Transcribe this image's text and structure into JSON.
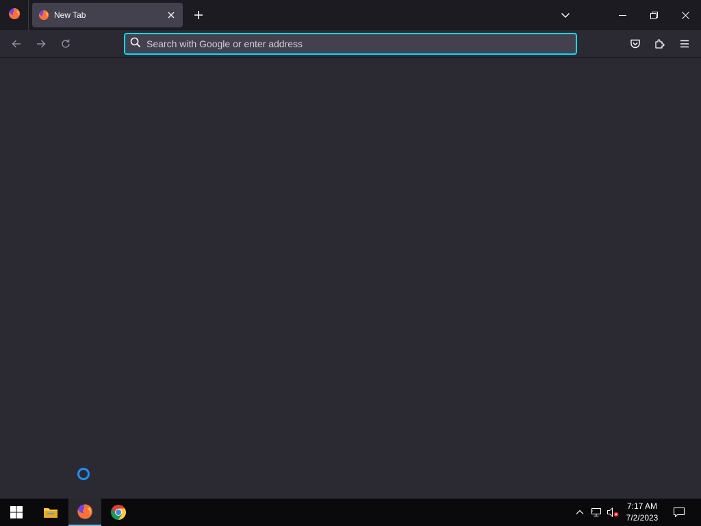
{
  "browser": {
    "tab": {
      "title": "New Tab"
    },
    "urlbar": {
      "placeholder": "Search with Google or enter address",
      "value": ""
    },
    "accent_color": "#00ddff"
  },
  "icons": {
    "firefox_menu": "firefox-logo-icon",
    "tab_favicon": "firefox-logo-icon",
    "tab_close": "close-icon",
    "new_tab": "plus-icon",
    "tab_list": "chevron-down-icon",
    "minimize": "minimize-icon",
    "restore": "restore-icon",
    "close_window": "close-icon",
    "back": "arrow-left-icon",
    "forward": "arrow-right-icon",
    "reload": "reload-icon",
    "search": "search-icon",
    "pocket": "pocket-icon",
    "extensions": "puzzle-icon",
    "menu": "hamburger-menu-icon"
  },
  "taskbar": {
    "apps": [
      "windows-start-icon",
      "file-explorer-icon",
      "firefox-icon",
      "chrome-icon"
    ],
    "clock": {
      "time": "7:17 AM",
      "date": "7/2/2023"
    },
    "tray": [
      "chevron-up-icon",
      "network-icon",
      "volume-muted-icon",
      "action-center-icon"
    ]
  }
}
